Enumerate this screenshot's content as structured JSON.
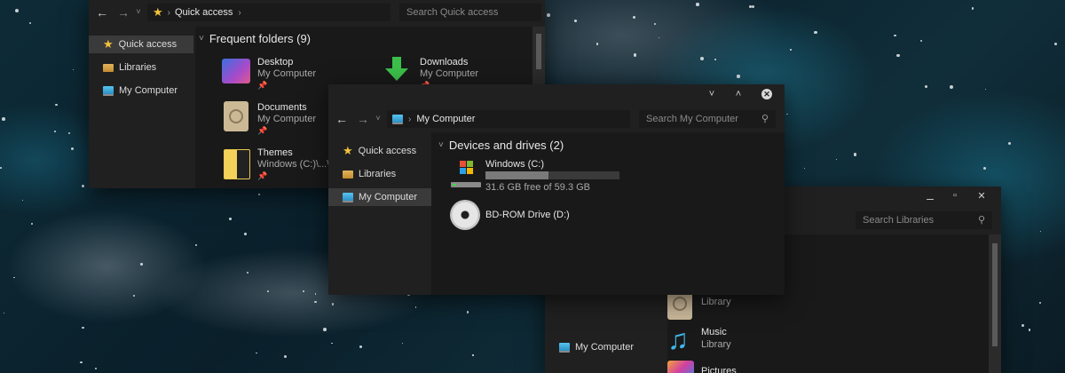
{
  "win_quick": {
    "address": [
      "Quick access"
    ],
    "search_placeholder": "Search Quick access",
    "nav": [
      "Quick access",
      "Libraries",
      "My Computer"
    ],
    "section": "Frequent folders (9)",
    "folders": [
      {
        "name": "Desktop",
        "sub": "My Computer"
      },
      {
        "name": "Downloads",
        "sub": "My Computer"
      },
      {
        "name": "Documents",
        "sub": "My Computer"
      },
      {
        "name": "Themes",
        "sub": "Windows (C:)\\...\\Re"
      }
    ]
  },
  "win_computer": {
    "address": "My Computer",
    "search_placeholder": "Search My Computer",
    "nav": [
      "Quick access",
      "Libraries",
      "My Computer"
    ],
    "section": "Devices and drives (2)",
    "drives": [
      {
        "name": "Windows (C:)",
        "free_text": "31.6 GB free of 59.3 GB",
        "used_fraction": 0.47
      },
      {
        "name": "BD-ROM Drive (D:)"
      }
    ]
  },
  "win_libraries": {
    "search_placeholder": "Search Libraries",
    "nav_visible": "My Computer",
    "items": [
      {
        "name": "",
        "sub": "Library"
      },
      {
        "name": "Music",
        "sub": "Library"
      },
      {
        "name": "Pictures",
        "sub": ""
      }
    ]
  },
  "colors": {
    "window_bg": "#202020",
    "content_bg": "#191919",
    "accent": "#2a8fc4",
    "star": "#f3c33b"
  }
}
